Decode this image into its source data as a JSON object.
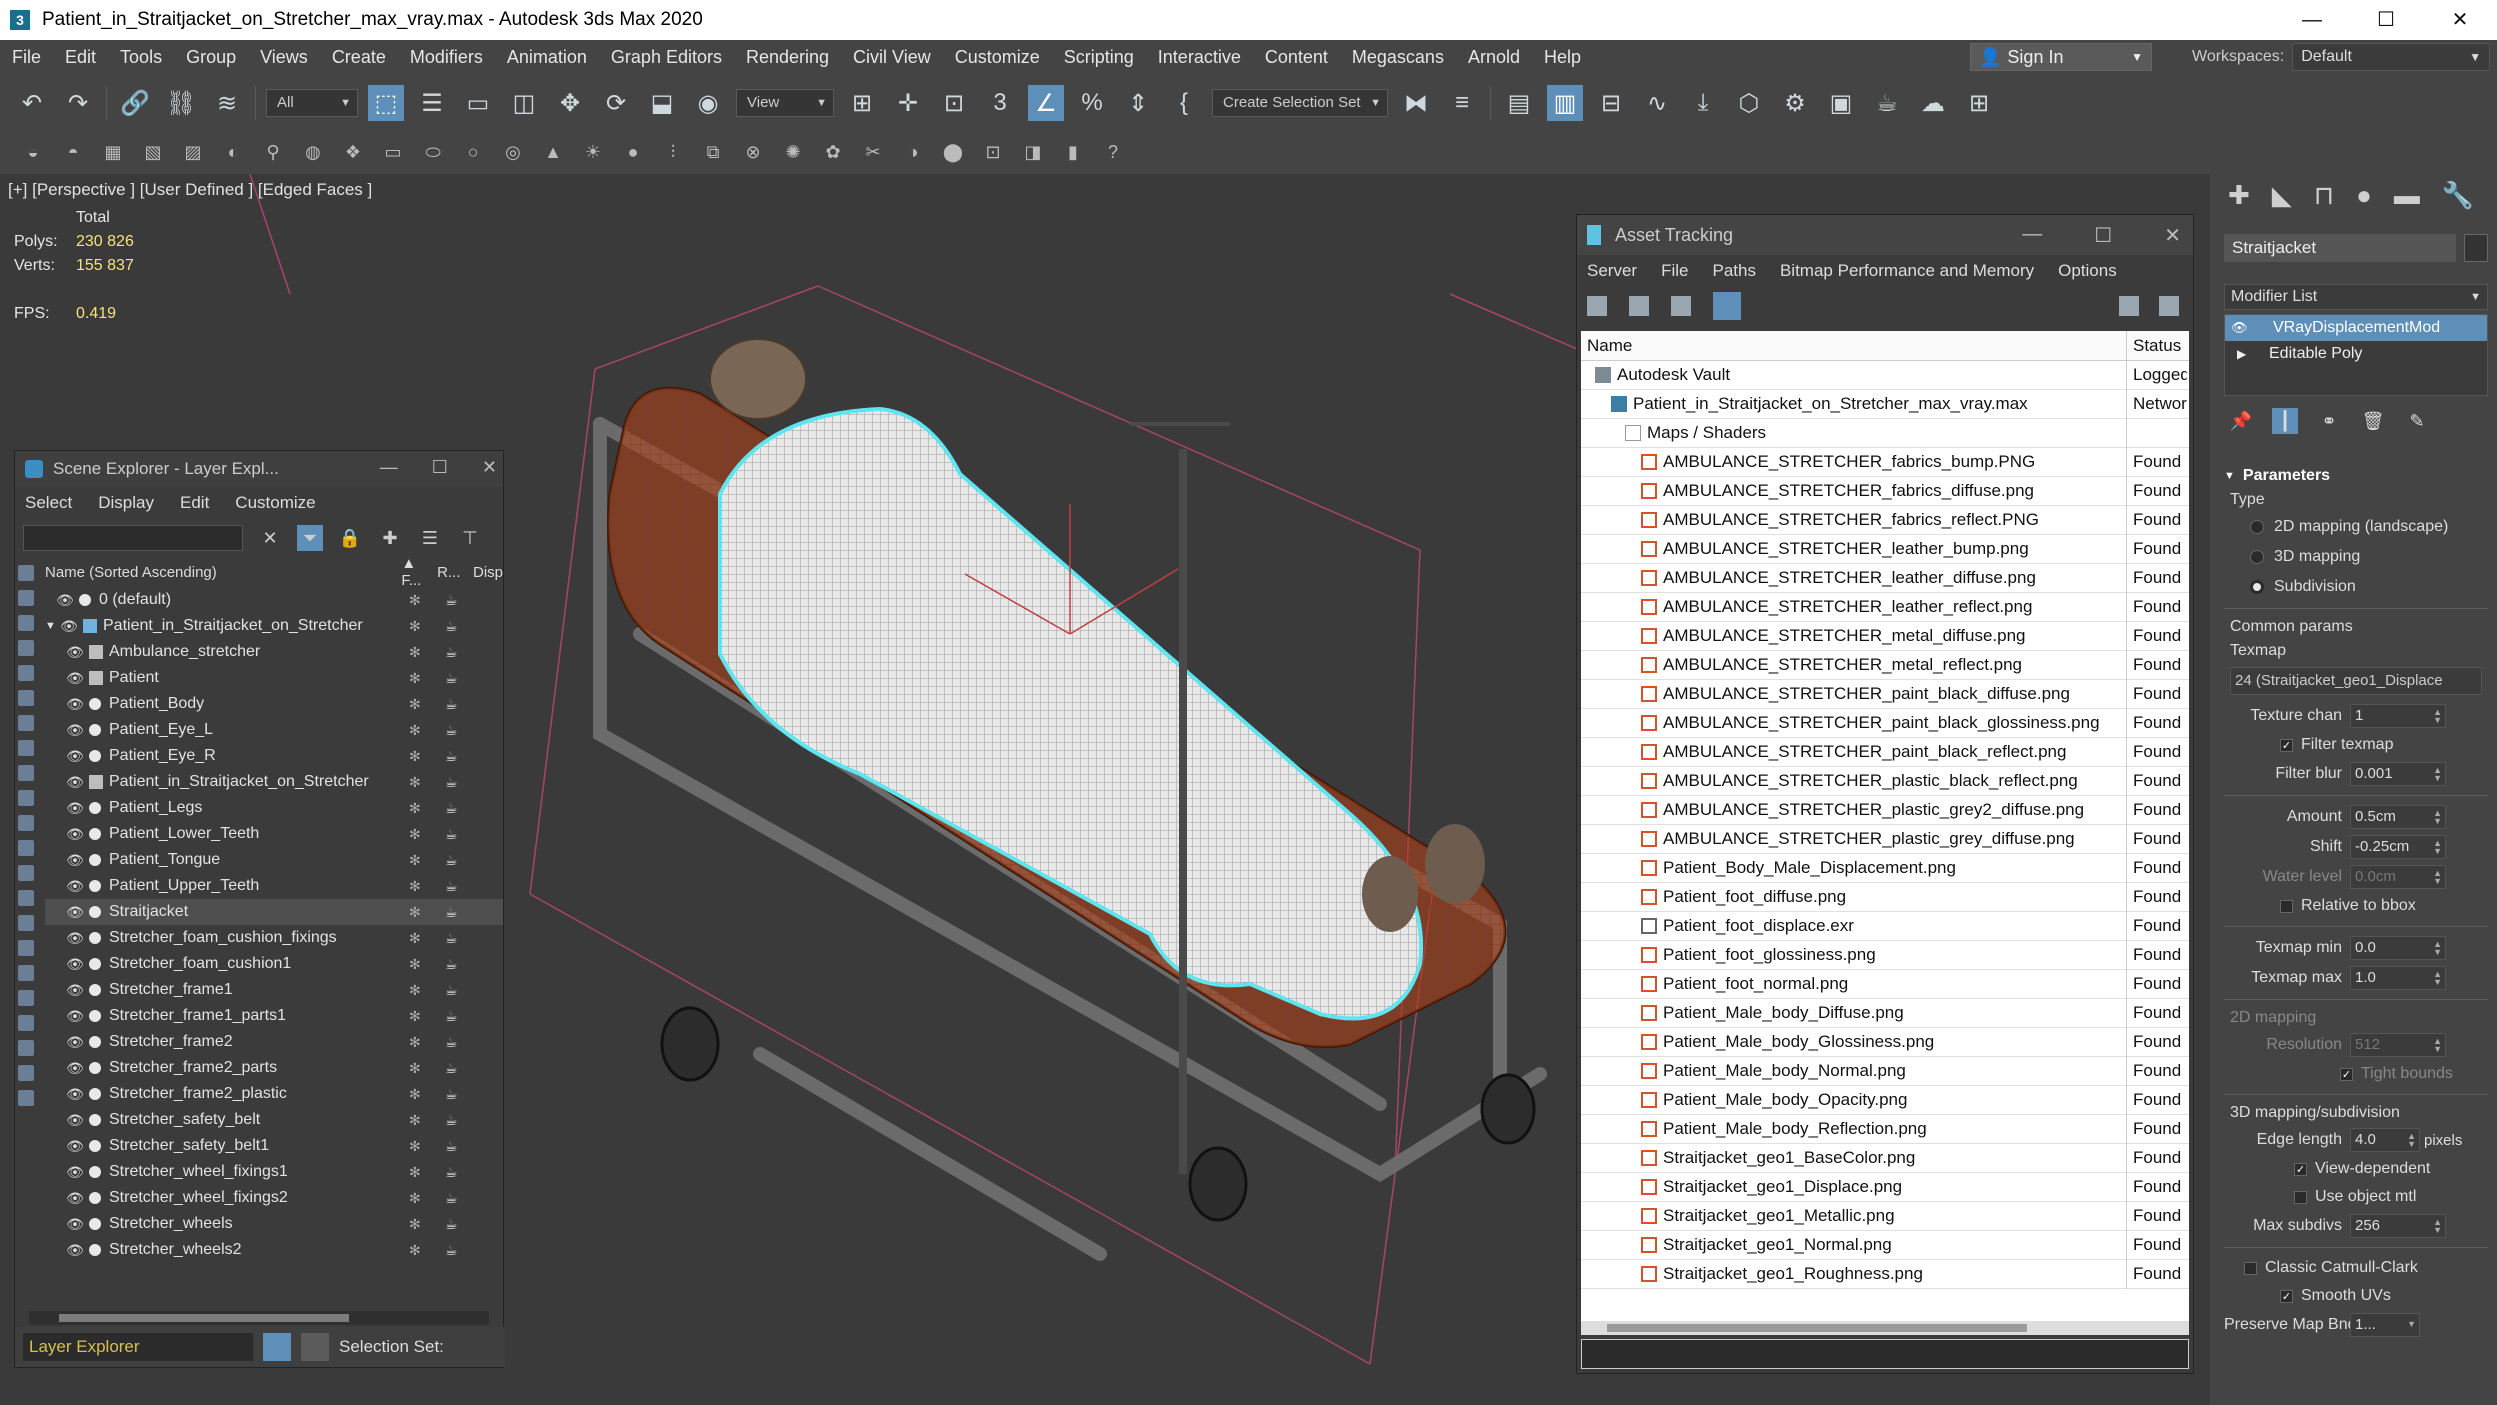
{
  "window": {
    "title": "Patient_in_Straitjacket_on_Stretcher_max_vray.max - Autodesk 3ds Max 2020",
    "minimize": "—",
    "maximize": "☐",
    "close": "✕"
  },
  "menu": [
    "File",
    "Edit",
    "Tools",
    "Group",
    "Views",
    "Create",
    "Modifiers",
    "Animation",
    "Graph Editors",
    "Rendering",
    "Civil View",
    "Customize",
    "Scripting",
    "Interactive",
    "Content",
    "Megascans",
    "Arnold",
    "Help"
  ],
  "signin": "Sign In",
  "workspaces": {
    "label": "Workspaces:",
    "value": "Default"
  },
  "toolbar": {
    "filter": "All",
    "refcoord": "View",
    "selection_set": "Create Selection Set"
  },
  "viewport": {
    "label": "[+] [Perspective ] [User Defined ] [Edged Faces ]",
    "stats": {
      "total_header": "Total",
      "polys_label": "Polys:",
      "polys_value": "230 826",
      "verts_label": "Verts:",
      "verts_value": "155 837",
      "fps_label": "FPS:",
      "fps_value": "0.419"
    }
  },
  "scene_explorer": {
    "title": "Scene Explorer - Layer Expl...",
    "menu": [
      "Select",
      "Display",
      "Edit",
      "Customize"
    ],
    "columns": {
      "name": "Name (Sorted Ascending)",
      "f": "▲ F...",
      "r": "R...",
      "d": "Disp"
    },
    "rows": [
      {
        "name": "0 (default)",
        "indent": 1,
        "kind": "layer-plain",
        "selected": false
      },
      {
        "name": "Patient_in_Straitjacket_on_Stretcher",
        "indent": 0,
        "kind": "layer",
        "selected": false
      },
      {
        "name": "Ambulance_stretcher",
        "indent": 2,
        "kind": "group",
        "selected": false
      },
      {
        "name": "Patient",
        "indent": 2,
        "kind": "group",
        "selected": false
      },
      {
        "name": "Patient_Body",
        "indent": 2,
        "kind": "object",
        "selected": false
      },
      {
        "name": "Patient_Eye_L",
        "indent": 2,
        "kind": "object",
        "selected": false
      },
      {
        "name": "Patient_Eye_R",
        "indent": 2,
        "kind": "object",
        "selected": false
      },
      {
        "name": "Patient_in_Straitjacket_on_Stretcher",
        "indent": 2,
        "kind": "group",
        "selected": false
      },
      {
        "name": "Patient_Legs",
        "indent": 2,
        "kind": "object",
        "selected": false
      },
      {
        "name": "Patient_Lower_Teeth",
        "indent": 2,
        "kind": "object",
        "selected": false
      },
      {
        "name": "Patient_Tongue",
        "indent": 2,
        "kind": "object",
        "selected": false
      },
      {
        "name": "Patient_Upper_Teeth",
        "indent": 2,
        "kind": "object",
        "selected": false
      },
      {
        "name": "Straitjacket",
        "indent": 2,
        "kind": "object",
        "selected": true
      },
      {
        "name": "Stretcher_foam_cushion_fixings",
        "indent": 2,
        "kind": "object",
        "selected": false
      },
      {
        "name": "Stretcher_foam_cushion1",
        "indent": 2,
        "kind": "object",
        "selected": false
      },
      {
        "name": "Stretcher_frame1",
        "indent": 2,
        "kind": "object",
        "selected": false
      },
      {
        "name": "Stretcher_frame1_parts1",
        "indent": 2,
        "kind": "object",
        "selected": false
      },
      {
        "name": "Stretcher_frame2",
        "indent": 2,
        "kind": "object",
        "selected": false
      },
      {
        "name": "Stretcher_frame2_parts",
        "indent": 2,
        "kind": "object",
        "selected": false
      },
      {
        "name": "Stretcher_frame2_plastic",
        "indent": 2,
        "kind": "object",
        "selected": false
      },
      {
        "name": "Stretcher_safety_belt",
        "indent": 2,
        "kind": "object",
        "selected": false
      },
      {
        "name": "Stretcher_safety_belt1",
        "indent": 2,
        "kind": "object",
        "selected": false
      },
      {
        "name": "Stretcher_wheel_fixings1",
        "indent": 2,
        "kind": "object",
        "selected": false
      },
      {
        "name": "Stretcher_wheel_fixings2",
        "indent": 2,
        "kind": "object",
        "selected": false
      },
      {
        "name": "Stretcher_wheels",
        "indent": 2,
        "kind": "object",
        "selected": false
      },
      {
        "name": "Stretcher_wheels2",
        "indent": 2,
        "kind": "object",
        "selected": false
      }
    ],
    "status": {
      "layer": "Layer Explorer",
      "selection_set": "Selection Set:"
    }
  },
  "asset_tracking": {
    "title": "Asset Tracking",
    "menu": [
      "Server",
      "File",
      "Paths",
      "Bitmap Performance and Memory",
      "Options"
    ],
    "columns": {
      "name": "Name",
      "status": "Status"
    },
    "rows": [
      {
        "name": "Autodesk Vault",
        "status": "Logged",
        "icon": "vault",
        "indent": 0
      },
      {
        "name": "Patient_in_Straitjacket_on_Stretcher_max_vray.max",
        "status": "Networ",
        "icon": "max",
        "indent": 1
      },
      {
        "name": "Maps / Shaders",
        "status": "",
        "icon": "folder",
        "indent": 2
      },
      {
        "name": "AMBULANCE_STRETCHER_fabrics_bump.PNG",
        "status": "Found",
        "icon": "img",
        "indent": 3
      },
      {
        "name": "AMBULANCE_STRETCHER_fabrics_diffuse.png",
        "status": "Found",
        "icon": "img",
        "indent": 3
      },
      {
        "name": "AMBULANCE_STRETCHER_fabrics_reflect.PNG",
        "status": "Found",
        "icon": "img",
        "indent": 3
      },
      {
        "name": "AMBULANCE_STRETCHER_leather_bump.png",
        "status": "Found",
        "icon": "img",
        "indent": 3
      },
      {
        "name": "AMBULANCE_STRETCHER_leather_diffuse.png",
        "status": "Found",
        "icon": "img",
        "indent": 3
      },
      {
        "name": "AMBULANCE_STRETCHER_leather_reflect.png",
        "status": "Found",
        "icon": "img",
        "indent": 3
      },
      {
        "name": "AMBULANCE_STRETCHER_metal_diffuse.png",
        "status": "Found",
        "icon": "img",
        "indent": 3
      },
      {
        "name": "AMBULANCE_STRETCHER_metal_reflect.png",
        "status": "Found",
        "icon": "img",
        "indent": 3
      },
      {
        "name": "AMBULANCE_STRETCHER_paint_black_diffuse.png",
        "status": "Found",
        "icon": "img",
        "indent": 3
      },
      {
        "name": "AMBULANCE_STRETCHER_paint_black_glossiness.png",
        "status": "Found",
        "icon": "img",
        "indent": 3
      },
      {
        "name": "AMBULANCE_STRETCHER_paint_black_reflect.png",
        "status": "Found",
        "icon": "img",
        "indent": 3
      },
      {
        "name": "AMBULANCE_STRETCHER_plastic_black_reflect.png",
        "status": "Found",
        "icon": "img",
        "indent": 3
      },
      {
        "name": "AMBULANCE_STRETCHER_plastic_grey2_diffuse.png",
        "status": "Found",
        "icon": "img",
        "indent": 3
      },
      {
        "name": "AMBULANCE_STRETCHER_plastic_grey_diffuse.png",
        "status": "Found",
        "icon": "img",
        "indent": 3
      },
      {
        "name": "Patient_Body_Male_Displacement.png",
        "status": "Found",
        "icon": "img",
        "indent": 3
      },
      {
        "name": "Patient_foot_diffuse.png",
        "status": "Found",
        "icon": "img",
        "indent": 3
      },
      {
        "name": "Patient_foot_displace.exr",
        "status": "Found",
        "icon": "exr",
        "indent": 3
      },
      {
        "name": "Patient_foot_glossiness.png",
        "status": "Found",
        "icon": "img",
        "indent": 3
      },
      {
        "name": "Patient_foot_normal.png",
        "status": "Found",
        "icon": "img",
        "indent": 3
      },
      {
        "name": "Patient_Male_body_Diffuse.png",
        "status": "Found",
        "icon": "img",
        "indent": 3
      },
      {
        "name": "Patient_Male_body_Glossiness.png",
        "status": "Found",
        "icon": "img",
        "indent": 3
      },
      {
        "name": "Patient_Male_body_Normal.png",
        "status": "Found",
        "icon": "img",
        "indent": 3
      },
      {
        "name": "Patient_Male_body_Opacity.png",
        "status": "Found",
        "icon": "img",
        "indent": 3
      },
      {
        "name": "Patient_Male_body_Reflection.png",
        "status": "Found",
        "icon": "img",
        "indent": 3
      },
      {
        "name": "Straitjacket_geo1_BaseColor.png",
        "status": "Found",
        "icon": "img",
        "indent": 3
      },
      {
        "name": "Straitjacket_geo1_Displace.png",
        "status": "Found",
        "icon": "img",
        "indent": 3
      },
      {
        "name": "Straitjacket_geo1_Metallic.png",
        "status": "Found",
        "icon": "img",
        "indent": 3
      },
      {
        "name": "Straitjacket_geo1_Normal.png",
        "status": "Found",
        "icon": "img",
        "indent": 3
      },
      {
        "name": "Straitjacket_geo1_Roughness.png",
        "status": "Found",
        "icon": "img",
        "indent": 3
      }
    ]
  },
  "command_panel": {
    "object_name": "Straitjacket",
    "modifier_list": "Modifier List",
    "stack": [
      {
        "name": "VRayDisplacementMod",
        "selected": true
      },
      {
        "name": "Editable Poly",
        "selected": false
      }
    ],
    "params": {
      "header": "Parameters",
      "type_label": "Type",
      "type_options": [
        {
          "label": "2D mapping (landscape)",
          "on": false
        },
        {
          "label": "3D mapping",
          "on": false
        },
        {
          "label": "Subdivision",
          "on": true
        }
      ],
      "common_params": "Common params",
      "texmap_label": "Texmap",
      "texmap_value": "24 (Straitjacket_geo1_Displace",
      "texture_chan": {
        "label": "Texture chan",
        "value": "1"
      },
      "filter_texmap": "Filter texmap",
      "filter_blur": {
        "label": "Filter blur",
        "value": "0.001"
      },
      "amount": {
        "label": "Amount",
        "value": "0.5cm"
      },
      "shift": {
        "label": "Shift",
        "value": "-0.25cm"
      },
      "water_level": {
        "label": "Water level",
        "value": "0.0cm"
      },
      "relative_bbox": "Relative to bbox",
      "texmap_min": {
        "label": "Texmap min",
        "value": "0.0"
      },
      "texmap_max": {
        "label": "Texmap max",
        "value": "1.0"
      },
      "mapping_2d": "2D mapping",
      "resolution": {
        "label": "Resolution",
        "value": "512"
      },
      "tight_bounds": "Tight bounds",
      "mapping_3d": "3D mapping/subdivision",
      "edge_length": {
        "label": "Edge length",
        "value": "4.0",
        "unit": "pixels"
      },
      "view_dependent": "View-dependent",
      "use_object_mtl": "Use object mtl",
      "max_subdivs": {
        "label": "Max subdivs",
        "value": "256"
      },
      "classic_catmull": "Classic Catmull-Clark",
      "smooth_uvs": "Smooth UVs",
      "preserve_map_bnd": {
        "label": "Preserve Map Bnd",
        "value": "1..."
      }
    }
  }
}
